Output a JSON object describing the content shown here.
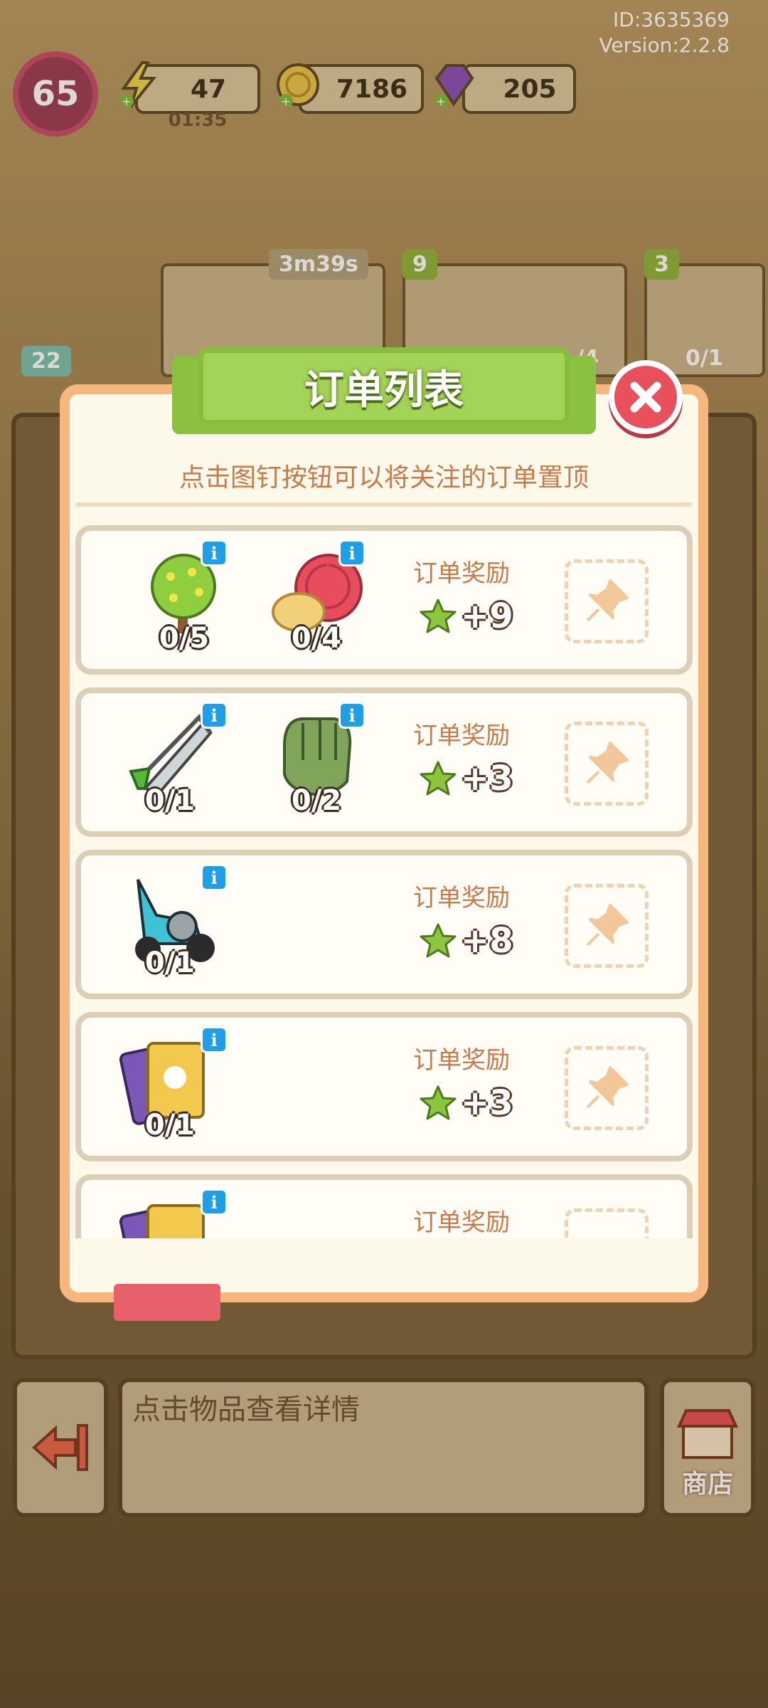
{
  "header": {
    "id_text": "ID:3635369",
    "version_text": "Version:2.2.8",
    "level": "65",
    "energy": "47",
    "energy_timer": "01:35",
    "coins": "7186",
    "gems": "205"
  },
  "background_orders": {
    "timer": "3m39s",
    "tags": [
      "22",
      "9",
      "3"
    ],
    "strip_count": "0/1",
    "strip_count2": "/4"
  },
  "modal": {
    "title": "订单列表",
    "hint": "点击图钉按钮可以将关注的订单置顶",
    "orders": [
      {
        "items": [
          {
            "icon": "flower-tree-icon",
            "count": "0/5"
          },
          {
            "icon": "snail-cat-icon",
            "count": "0/4"
          }
        ],
        "reward_label": "订单奖励",
        "reward": "+9"
      },
      {
        "items": [
          {
            "icon": "saw-icon",
            "count": "0/1"
          },
          {
            "icon": "glove-icon",
            "count": "0/2"
          }
        ],
        "reward_label": "订单奖励",
        "reward": "+3"
      },
      {
        "items": [
          {
            "icon": "scooter-icon",
            "count": "0/1"
          }
        ],
        "reward_label": "订单奖励",
        "reward": "+8"
      },
      {
        "items": [
          {
            "icon": "cards-icon",
            "count": "0/1"
          }
        ],
        "reward_label": "订单奖励",
        "reward": "+3"
      },
      {
        "items": [
          {
            "icon": "cards-icon",
            "count": ""
          }
        ],
        "reward_label": "订单奖励",
        "reward": ""
      }
    ]
  },
  "footer": {
    "info_text": "点击物品查看详情",
    "shop_label": "商店"
  },
  "colors": {
    "accent_green": "#a4d457",
    "modal_border": "#f6b77f",
    "close_red": "#e8505b",
    "info_blue": "#1e9fe8",
    "reward_text": "#c87a4a"
  }
}
